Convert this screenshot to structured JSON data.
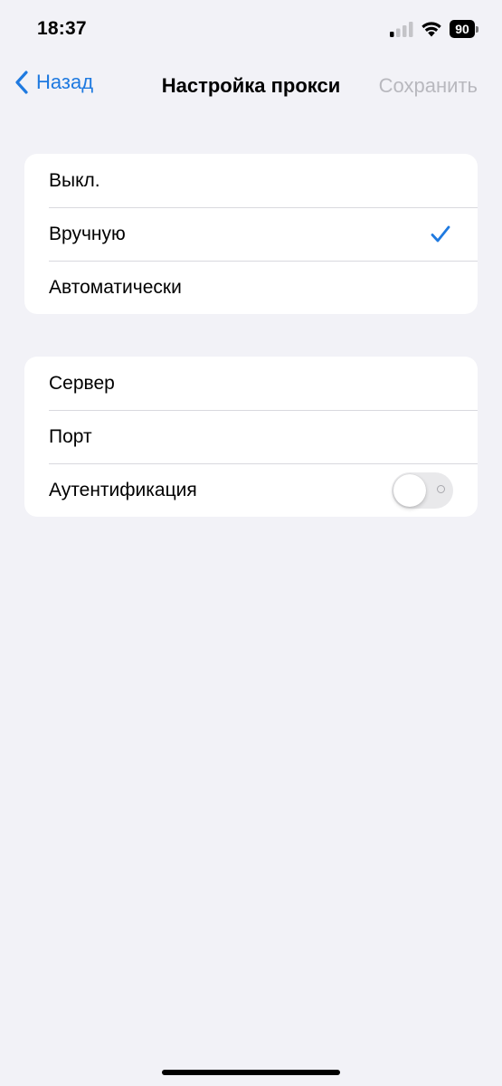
{
  "status_bar": {
    "time": "18:37",
    "battery_level": "90",
    "icons": [
      "signal-icon",
      "wifi-icon",
      "battery-icon"
    ]
  },
  "nav": {
    "back_label": "Назад",
    "title": "Настройка прокси",
    "save_label": "Сохранить",
    "accent_color": "#1f7ae0",
    "disabled_color": "#b8b8be"
  },
  "proxy_modes": {
    "items": [
      {
        "label": "Выкл.",
        "selected": false
      },
      {
        "label": "Вручную",
        "selected": true
      },
      {
        "label": "Автоматически",
        "selected": false
      }
    ]
  },
  "server_settings": {
    "server_label": "Сервер",
    "port_label": "Порт",
    "auth_label": "Аутентификация",
    "auth_enabled": false
  }
}
